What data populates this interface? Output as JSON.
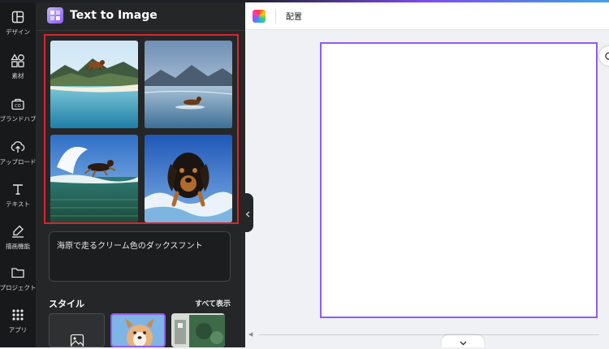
{
  "rail": {
    "items": [
      {
        "label": "デザイン",
        "icon": "layout-icon"
      },
      {
        "label": "素材",
        "icon": "shapes-icon"
      },
      {
        "label": "ブランドハブ",
        "icon": "brand-hub-icon"
      },
      {
        "label": "アップロード",
        "icon": "upload-icon"
      },
      {
        "label": "テキスト",
        "icon": "text-icon"
      },
      {
        "label": "描画機能",
        "icon": "draw-icon"
      },
      {
        "label": "プロジェクト",
        "icon": "folder-icon"
      },
      {
        "label": "アプリ",
        "icon": "apps-grid-icon"
      }
    ]
  },
  "panel": {
    "title": "Text to Image",
    "prompt_text": "海原で走るクリーム色のダックスフント",
    "style_section_title": "スタイル",
    "see_all_label": "すべて表示",
    "highlight_color": "#d7262e",
    "generated_images": [
      {
        "subject": "dachshund leaping over lake near mountains"
      },
      {
        "subject": "dachshund running on water with mountains"
      },
      {
        "subject": "dachshund jumping over ocean wave"
      },
      {
        "subject": "dachshund running toward viewer through surf"
      }
    ]
  },
  "toolbar": {
    "arrange_label": "配置"
  },
  "canvas": {
    "page_border_color": "#8d5ef0",
    "background_color": "#ffffff"
  },
  "colors": {
    "rail_bg": "#18191b",
    "panel_bg": "#252627",
    "workspace_bg": "#f0f1f4",
    "accent_purple": "#8d5ef0"
  }
}
